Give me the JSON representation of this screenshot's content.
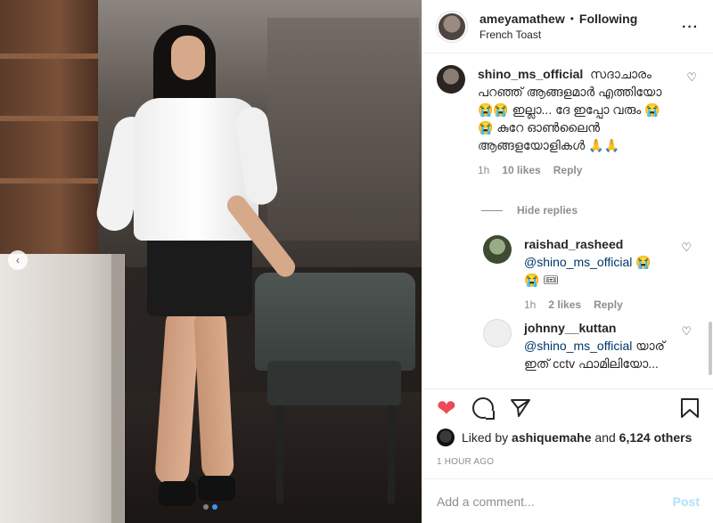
{
  "header": {
    "username": "ameyamathew",
    "separator": "•",
    "follow_status": "Following",
    "location": "French Toast",
    "more_label": "···"
  },
  "comments": [
    {
      "username": "shino_ms_official",
      "text": "സദാചാരം പറഞ്ഞ് ആങ്ങളമാർ എത്തിയോ 😭😭 ഇല്ലാ... ദേ ഇപ്പോ വരും 😭😭 കുറേ ഓൺലൈൻ ആങ്ങളയോളികൾ 🙏🙏",
      "time": "1h",
      "likes": "10 likes",
      "reply": "Reply",
      "avatar_icon": "user-avatar-icon"
    },
    {
      "username": "raishad_rasheed",
      "mention": "@shino_ms_official",
      "text": "😭😭 🎟",
      "time": "1h",
      "likes": "2 likes",
      "reply": "Reply",
      "avatar_icon": "user-avatar-icon"
    },
    {
      "username": "johnny__kuttan",
      "mention": "@shino_ms_official",
      "text": "യാര് ഇത് cctv ഫാമിലിയോ...",
      "avatar_icon": "default-avatar-icon"
    }
  ],
  "hide_replies": "Hide replies",
  "likes": {
    "prefix": "Liked by",
    "user": "ashiquemahe",
    "connector": "and",
    "others": "6,124 others"
  },
  "time_ago": "1 HOUR AGO",
  "add_comment": {
    "placeholder": "Add a comment...",
    "post_label": "Post"
  },
  "colors": {
    "heart": "#ed4956",
    "mention": "#00376b",
    "post_disabled": "#b2dffc",
    "carousel_active": "#3897f0"
  },
  "carousel": {
    "prev_icon": "chevron-left-icon",
    "dots": 2,
    "active_index": 1
  }
}
